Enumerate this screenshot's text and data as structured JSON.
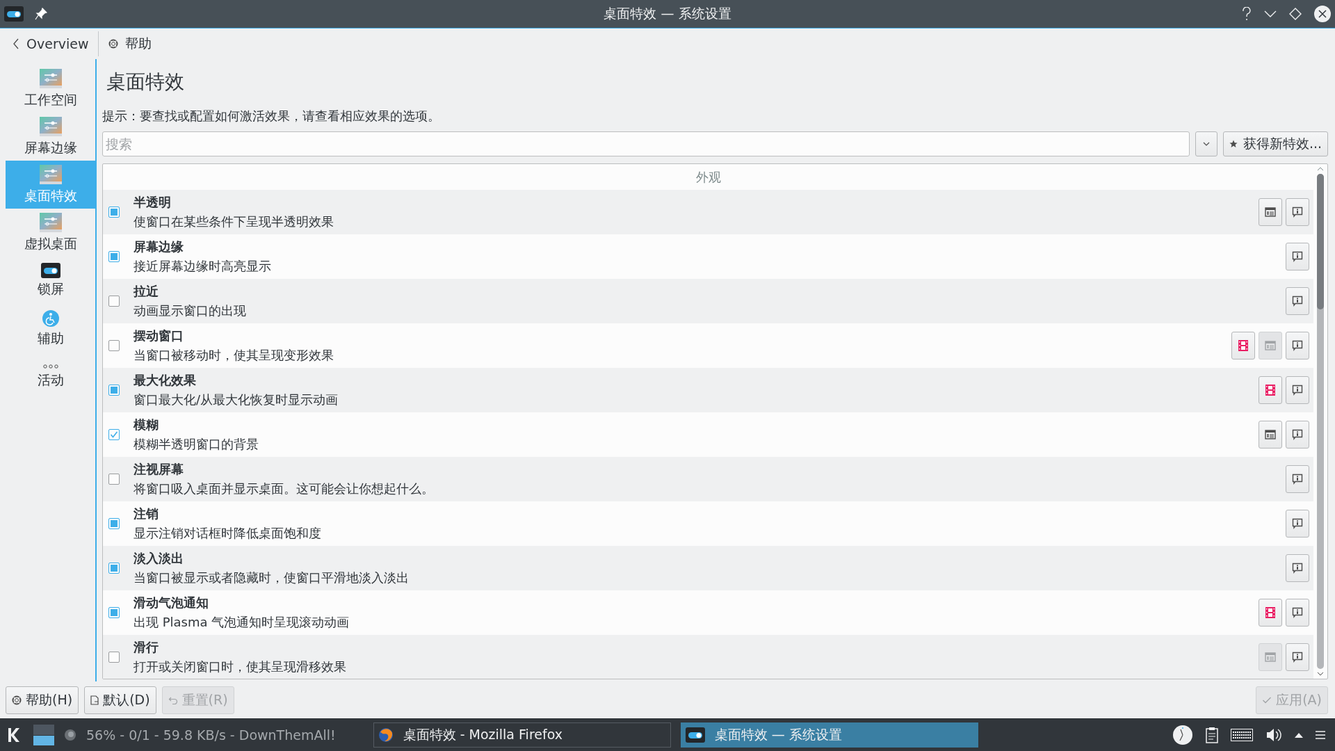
{
  "window": {
    "title": "桌面特效 — 系统设置"
  },
  "toolbar": {
    "back": "Overview",
    "help": "帮助"
  },
  "sidebar": {
    "items": [
      {
        "label": "工作空间",
        "selected": false
      },
      {
        "label": "屏幕边缘",
        "selected": false
      },
      {
        "label": "桌面特效",
        "selected": true
      },
      {
        "label": "虚拟桌面",
        "selected": false
      },
      {
        "label": "锁屏",
        "selected": false
      },
      {
        "label": "辅助",
        "selected": false
      },
      {
        "label": "活动",
        "selected": false
      }
    ]
  },
  "page": {
    "heading": "桌面特效",
    "hint": "提示：要查找或配置如何激活效果，请查看相应效果的选项。",
    "search": {
      "placeholder": "搜索"
    },
    "get_new_button": "获得新特效..."
  },
  "effects": {
    "group": "外观",
    "rows": [
      {
        "title": "半透明",
        "description": "使窗口在某些条件下呈现半透明效果",
        "checked": true,
        "partial": true,
        "buttons": [
          {
            "kind": "config",
            "disabled": false
          },
          {
            "kind": "info",
            "disabled": false
          }
        ]
      },
      {
        "title": "屏幕边缘",
        "description": "接近屏幕边缘时高亮显示",
        "checked": true,
        "partial": true,
        "buttons": [
          {
            "kind": "info",
            "disabled": false
          }
        ]
      },
      {
        "title": "拉近",
        "description": "动画显示窗口的出现",
        "checked": false,
        "buttons": [
          {
            "kind": "info",
            "disabled": false
          }
        ]
      },
      {
        "title": "摆动窗口",
        "description": "当窗口被移动时，使其呈现变形效果",
        "checked": false,
        "buttons": [
          {
            "kind": "video",
            "disabled": false
          },
          {
            "kind": "config",
            "disabled": true
          },
          {
            "kind": "info",
            "disabled": false
          }
        ]
      },
      {
        "title": "最大化效果",
        "description": "窗口最大化/从最大化恢复时显示动画",
        "checked": true,
        "partial": true,
        "buttons": [
          {
            "kind": "video",
            "disabled": false
          },
          {
            "kind": "info",
            "disabled": false
          }
        ]
      },
      {
        "title": "模糊",
        "description": "模糊半透明窗口的背景",
        "checked": true,
        "partial": false,
        "buttons": [
          {
            "kind": "config",
            "disabled": false
          },
          {
            "kind": "info",
            "disabled": false
          }
        ]
      },
      {
        "title": "注视屏幕",
        "description": "将窗口吸入桌面并显示桌面。这可能会让你想起什么。",
        "checked": false,
        "buttons": [
          {
            "kind": "info",
            "disabled": false
          }
        ]
      },
      {
        "title": "注销",
        "description": "显示注销对话框时降低桌面饱和度",
        "checked": true,
        "partial": true,
        "buttons": [
          {
            "kind": "info",
            "disabled": false
          }
        ]
      },
      {
        "title": "淡入淡出",
        "description": "当窗口被显示或者隐藏时，使窗口平滑地淡入淡出",
        "checked": true,
        "partial": true,
        "buttons": [
          {
            "kind": "info",
            "disabled": false
          }
        ]
      },
      {
        "title": "滑动气泡通知",
        "description": "出现 Plasma 气泡通知时呈现滚动动画",
        "checked": true,
        "partial": true,
        "buttons": [
          {
            "kind": "video",
            "disabled": false
          },
          {
            "kind": "info",
            "disabled": false
          }
        ]
      },
      {
        "title": "滑行",
        "description": "打开或关闭窗口时，使其呈现滑移效果",
        "checked": false,
        "buttons": [
          {
            "kind": "config",
            "disabled": true
          },
          {
            "kind": "info",
            "disabled": false
          }
        ]
      }
    ]
  },
  "footer": {
    "left": [
      {
        "label": "帮助(H)",
        "disabled": false
      },
      {
        "label": "默认(D)",
        "disabled": false
      },
      {
        "label": "重置(R)",
        "disabled": true
      }
    ],
    "right": [
      {
        "label": "应用(A)",
        "disabled": true
      }
    ]
  },
  "taskbar": {
    "status": "56% - 0/1 - 59.8 KB/s - DownThemAll!",
    "tasks": [
      {
        "label": "桌面特效 - Mozilla Firefox",
        "selected": false
      },
      {
        "label": "桌面特效 — 系统设置",
        "selected": true
      }
    ]
  }
}
